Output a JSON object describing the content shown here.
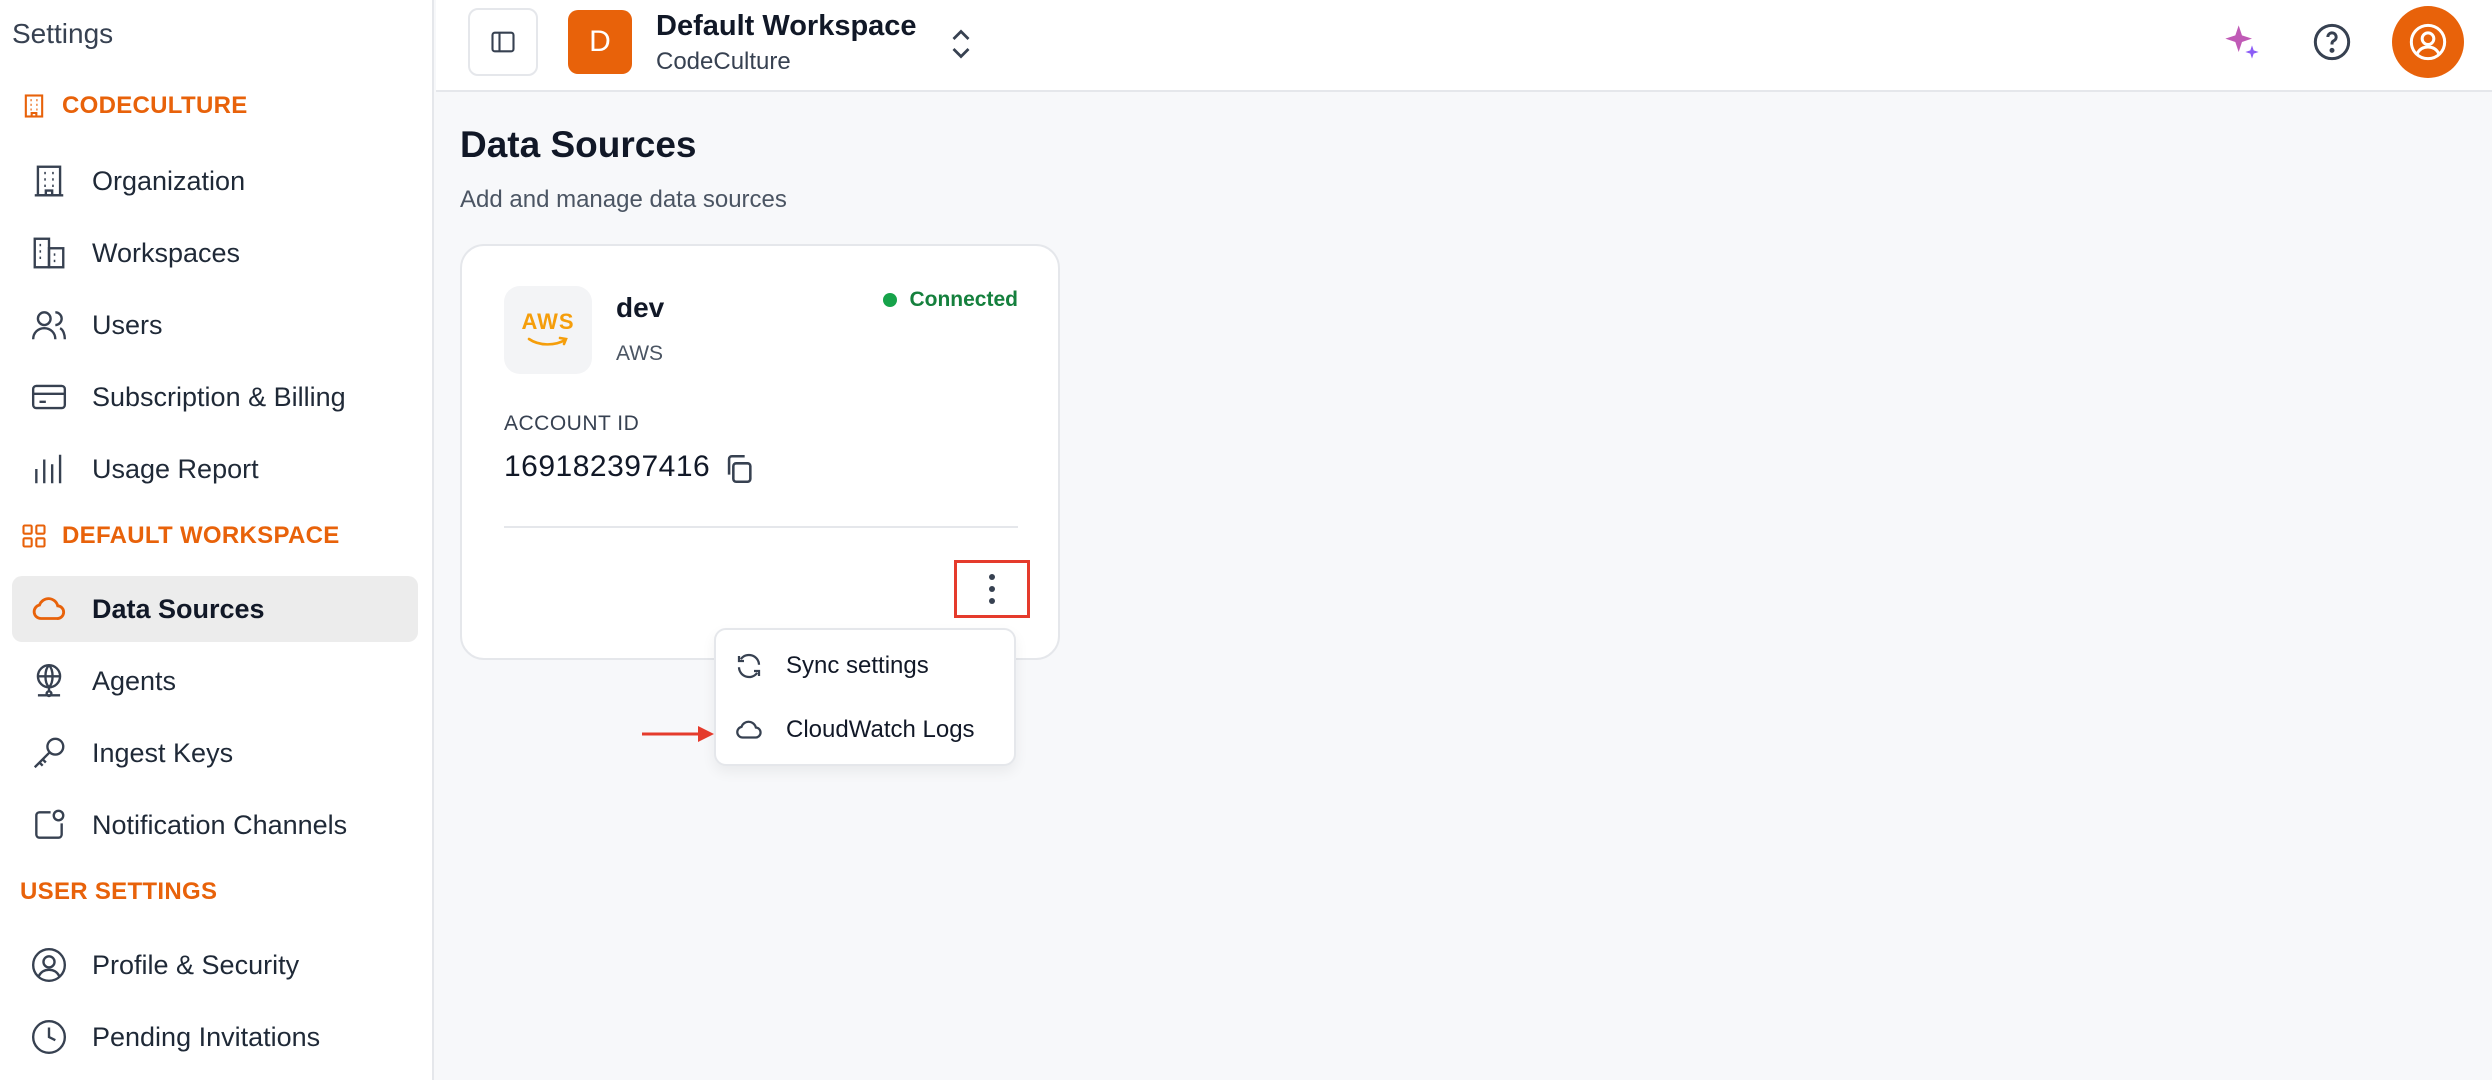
{
  "sidebar": {
    "title": "Settings",
    "sections": [
      {
        "label": "CODECULTURE"
      },
      {
        "label": "DEFAULT WORKSPACE"
      },
      {
        "label": "USER SETTINGS"
      }
    ],
    "items": [
      {
        "label": "Organization",
        "icon": "building-icon"
      },
      {
        "label": "Workspaces",
        "icon": "buildings-icon"
      },
      {
        "label": "Users",
        "icon": "users-icon"
      },
      {
        "label": "Subscription & Billing",
        "icon": "credit-card-icon"
      },
      {
        "label": "Usage Report",
        "icon": "bar-chart-icon"
      },
      {
        "label": "Data Sources",
        "icon": "cloud-icon",
        "active": true
      },
      {
        "label": "Agents",
        "icon": "globe-network-icon"
      },
      {
        "label": "Ingest Keys",
        "icon": "key-icon"
      },
      {
        "label": "Notification Channels",
        "icon": "notification-icon"
      },
      {
        "label": "Profile & Security",
        "icon": "user-circle-icon"
      },
      {
        "label": "Pending Invitations",
        "icon": "clock-icon"
      }
    ]
  },
  "header": {
    "workspace_initial": "D",
    "workspace_name": "Default Workspace",
    "organization_name": "CodeCulture"
  },
  "main": {
    "title": "Data Sources",
    "subtitle": "Add and manage data sources",
    "card": {
      "logo_text": "AWS",
      "name": "dev",
      "type": "AWS",
      "status": "Connected",
      "account_label": "ACCOUNT ID",
      "account_id": "169182397416"
    },
    "menu": [
      {
        "label": "Sync settings",
        "icon": "sync-icon"
      },
      {
        "label": "CloudWatch Logs",
        "icon": "cloud-icon"
      }
    ]
  },
  "colors": {
    "accent": "#e8620a",
    "status_connected": "#15803d",
    "highlight": "#e53b2c"
  }
}
